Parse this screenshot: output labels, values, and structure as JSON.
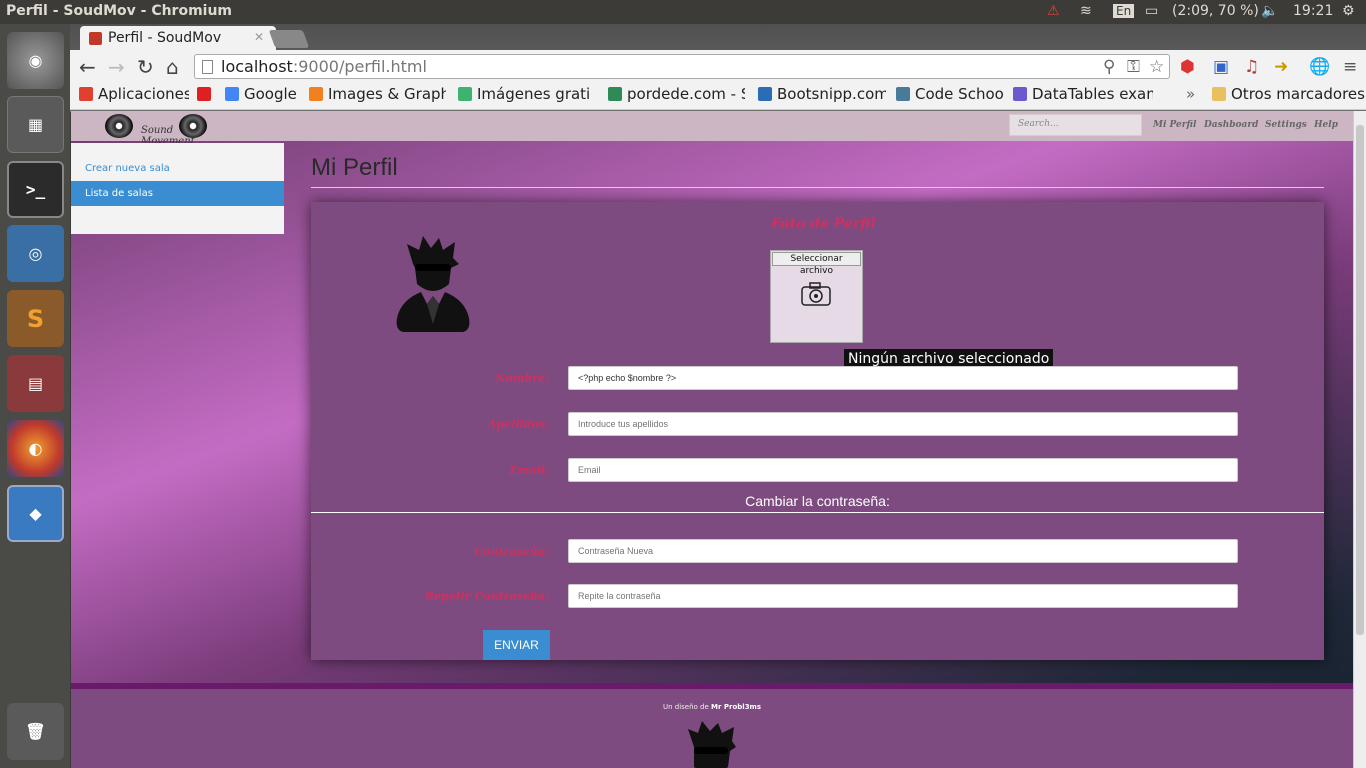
{
  "system": {
    "window_title": "Perfil - SoudMov - Chromium",
    "keyboard_layout": "En",
    "battery": "(2:09, 70 %)",
    "clock": "19:21"
  },
  "browser": {
    "tab_title": "Perfil - SoudMov",
    "url_host": "localhost",
    "url_path": ":9000/perfil.html",
    "bookmarks": [
      {
        "label": "Aplicaciones",
        "color": "#e04030"
      },
      {
        "label": "",
        "color": "#e02020"
      },
      {
        "label": "Google",
        "color": "#4285f4"
      },
      {
        "label": "Images & Graphic",
        "color": "#f08020"
      },
      {
        "label": "Imágenes gratis -",
        "color": "#3cb371"
      },
      {
        "label": "pordede.com - Se",
        "color": "#2e8b57"
      },
      {
        "label": "Bootsnipp.com",
        "color": "#2a6db5"
      },
      {
        "label": "Code School",
        "color": "#4a7a9a"
      },
      {
        "label": "DataTables exam",
        "color": "#6a5acd"
      }
    ],
    "more_bookmarks": "»",
    "other_bookmarks": "Otros marcadores"
  },
  "site": {
    "logo_text": "Sound Movement",
    "search_placeholder": "Search...",
    "nav": [
      "Mi Perfil",
      "Dashboard",
      "Settings",
      "Help"
    ],
    "sidebar": [
      {
        "label": "Crear nueva sala",
        "active": false
      },
      {
        "label": "Lista de salas",
        "active": true
      }
    ],
    "page_title": "Mi Perfil",
    "photo_title": "Foto de Perfil",
    "file_button": "Seleccionar archivo",
    "file_tooltip": "Ningún archivo seleccionado",
    "fields": [
      {
        "label": "Nombre:",
        "value": "<?php echo $nombre ?>",
        "placeholder": ""
      },
      {
        "label": "Apellidos:",
        "value": "",
        "placeholder": "Introduce tus apellidos"
      },
      {
        "label": "Email:",
        "value": "",
        "placeholder": "Email"
      }
    ],
    "password_section_title": "Cambiar la contraseña:",
    "password_fields": [
      {
        "label": "Contraseña:",
        "placeholder": "Contraseña Nueva"
      },
      {
        "label": "Repetir Contraseña:",
        "placeholder": "Repite la contraseña"
      }
    ],
    "submit_label": "ENVIAR",
    "footer_prefix": "Un diseño de",
    "footer_author": "Mr Probl3ms"
  },
  "colors": {
    "accent_red": "#d03060",
    "card_purple": "#7d4b7f",
    "sidebar_active": "#3a8dd0",
    "submit_blue": "#3a8dd0"
  }
}
